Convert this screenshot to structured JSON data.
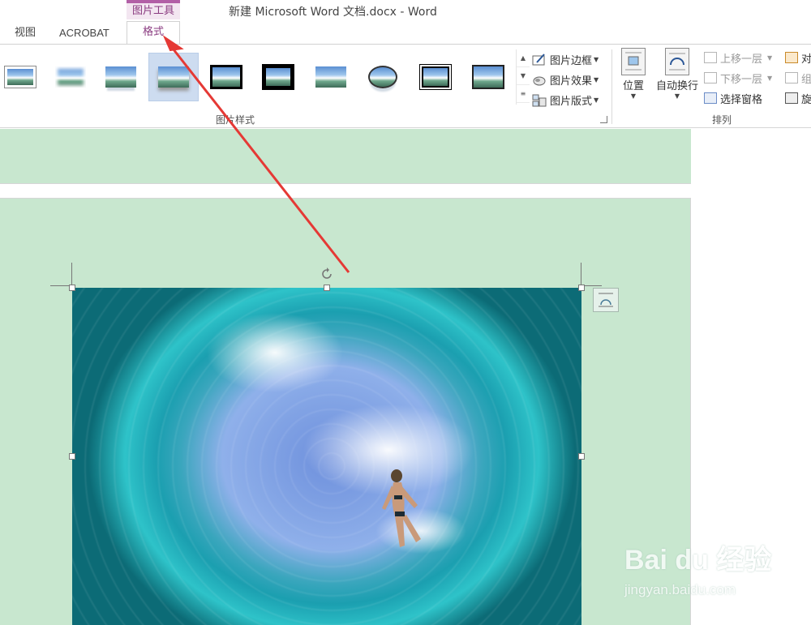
{
  "window": {
    "title": "新建 Microsoft Word 文档.docx - Word"
  },
  "context_tab": {
    "label": "图片工具",
    "color": "#b25fa6"
  },
  "tabs": [
    {
      "label": "视图"
    },
    {
      "label": "ACROBAT"
    },
    {
      "label": "格式",
      "active": true
    }
  ],
  "ribbon": {
    "picture_styles": {
      "group_label": "图片样式",
      "commands": [
        {
          "label": "图片边框",
          "icon": "picture-border-icon"
        },
        {
          "label": "图片效果",
          "icon": "picture-effects-icon"
        },
        {
          "label": "图片版式",
          "icon": "picture-layout-icon"
        }
      ],
      "gallery_count": 10,
      "selected_index": 3
    },
    "arrange": {
      "group_label": "排列",
      "position": "位置",
      "wrap_text": "自动换行",
      "bring_forward": "上移一层",
      "send_backward": "下移一层",
      "selection_pane": "选择窗格",
      "align": "对",
      "group": "组",
      "rotate": "旋"
    }
  },
  "watermark": {
    "brand": "Bai du 经验",
    "url": "jingyan.baidu.com"
  },
  "colors": {
    "page_background": "#c8e7cf",
    "annotation_arrow": "#e53935",
    "accent": "#8a3b80"
  }
}
